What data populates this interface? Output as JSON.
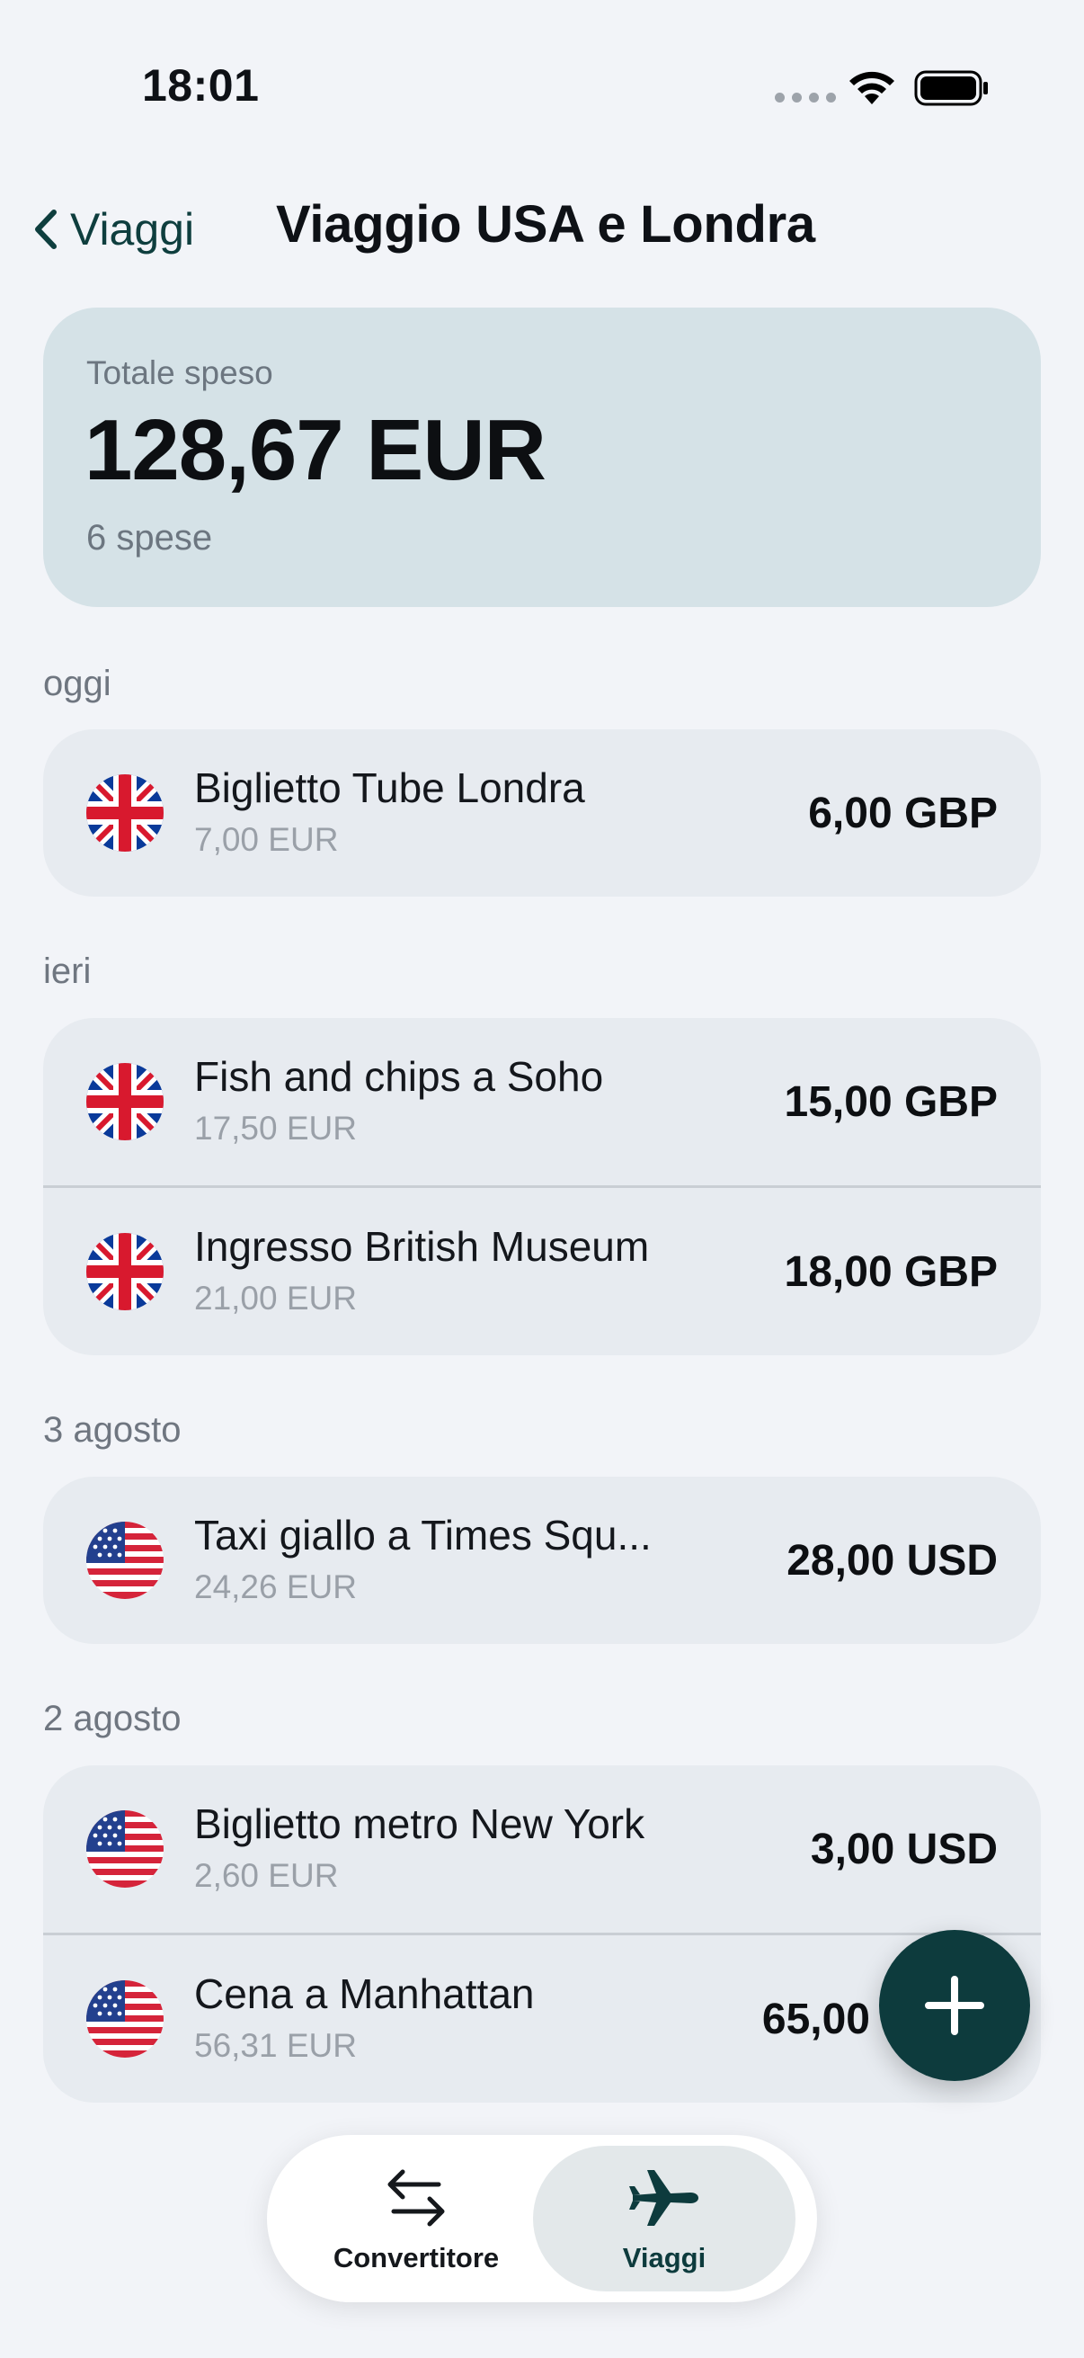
{
  "status_bar": {
    "time": "18:01"
  },
  "nav": {
    "back_label": "Viaggi",
    "title": "Viaggio USA e Londra"
  },
  "summary": {
    "label": "Totale speso",
    "amount": "128,67 EUR",
    "count": "6 spese"
  },
  "sections": [
    {
      "label": "oggi",
      "items": [
        {
          "flag": "uk-flag-icon",
          "name": "Biglietto Tube Londra",
          "converted": "7,00 EUR",
          "amount": "6,00 GBP"
        }
      ]
    },
    {
      "label": "ieri",
      "items": [
        {
          "flag": "uk-flag-icon",
          "name": "Fish and chips a Soho",
          "converted": "17,50 EUR",
          "amount": "15,00 GBP"
        },
        {
          "flag": "uk-flag-icon",
          "name": "Ingresso British Museum",
          "converted": "21,00 EUR",
          "amount": "18,00 GBP"
        }
      ]
    },
    {
      "label": "3 agosto",
      "items": [
        {
          "flag": "us-flag-icon",
          "name": "Taxi giallo a Times Squ...",
          "converted": "24,26 EUR",
          "amount": "28,00 USD"
        }
      ]
    },
    {
      "label": "2 agosto",
      "items": [
        {
          "flag": "us-flag-icon",
          "name": "Biglietto metro New York",
          "converted": "2,60 EUR",
          "amount": "3,00 USD"
        },
        {
          "flag": "us-flag-icon",
          "name": "Cena a Manhattan",
          "converted": "56,31 EUR",
          "amount": "65,00"
        }
      ]
    }
  ],
  "tabs": [
    {
      "label": "Convertitore",
      "icon": "arrows-left-right-icon",
      "selected": false
    },
    {
      "label": "Viaggi",
      "icon": "airplane-icon",
      "selected": true
    }
  ],
  "fab": {
    "icon": "plus-icon"
  },
  "colors": {
    "accent": "#0D3B3D",
    "summary_bg": "#D5E2E7",
    "card_bg": "#E7EBF0",
    "background": "#F2F4F8"
  }
}
